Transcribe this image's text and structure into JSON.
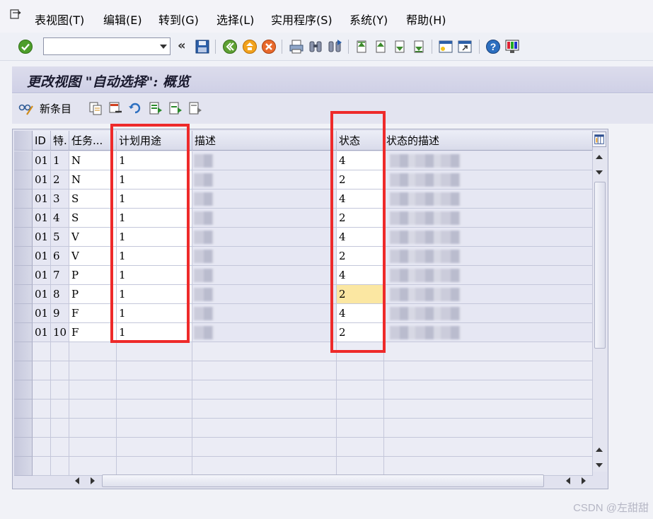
{
  "menu": {
    "items": [
      {
        "label": "表视图(T)",
        "name": "menu-table-view"
      },
      {
        "label": "编辑(E)",
        "name": "menu-edit"
      },
      {
        "label": "转到(G)",
        "name": "menu-goto"
      },
      {
        "label": "选择(L)",
        "name": "menu-selection"
      },
      {
        "label": "实用程序(S)",
        "name": "menu-utilities"
      },
      {
        "label": "系统(Y)",
        "name": "menu-system"
      },
      {
        "label": "帮助(H)",
        "name": "menu-help"
      }
    ]
  },
  "toolbar": {
    "command_value": "",
    "chevron": "«"
  },
  "title": "更改视图 \"自动选择\": 概览",
  "app_toolbar": {
    "new_entries_label": "新条目"
  },
  "table": {
    "headers": {
      "id": "ID",
      "special": "特.",
      "task": "任务...",
      "plan_usage": "计划用途",
      "description": "描述",
      "status": "状态",
      "status_desc": "状态的描述"
    },
    "rows": [
      {
        "id": "01",
        "special": "1",
        "task": "N",
        "plan_usage": "1",
        "status": "4"
      },
      {
        "id": "01",
        "special": "2",
        "task": "N",
        "plan_usage": "1",
        "status": "2"
      },
      {
        "id": "01",
        "special": "3",
        "task": "S",
        "plan_usage": "1",
        "status": "4"
      },
      {
        "id": "01",
        "special": "4",
        "task": "S",
        "plan_usage": "1",
        "status": "2"
      },
      {
        "id": "01",
        "special": "5",
        "task": "V",
        "plan_usage": "1",
        "status": "4"
      },
      {
        "id": "01",
        "special": "6",
        "task": "V",
        "plan_usage": "1",
        "status": "2"
      },
      {
        "id": "01",
        "special": "7",
        "task": "P",
        "plan_usage": "1",
        "status": "4"
      },
      {
        "id": "01",
        "special": "8",
        "task": "P",
        "plan_usage": "1",
        "status": "2"
      },
      {
        "id": "01",
        "special": "9",
        "task": "F",
        "plan_usage": "1",
        "status": "4"
      },
      {
        "id": "01",
        "special": "10",
        "task": "F",
        "plan_usage": "1",
        "status": "2"
      }
    ],
    "focused_row": 7,
    "highlight_color": "#ee2a2a"
  },
  "watermark": "CSDN @左甜甜"
}
